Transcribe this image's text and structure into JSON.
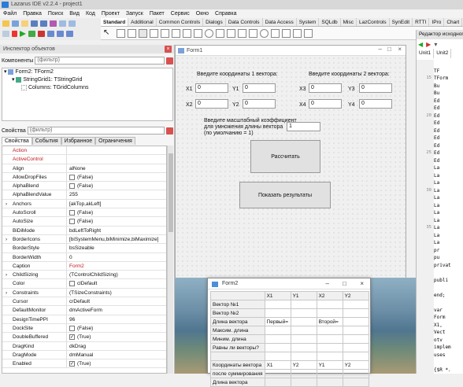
{
  "app": {
    "title": "Lazarus IDE v2.2.4 - project1"
  },
  "menu": [
    "Файл",
    "Правка",
    "Поиск",
    "Вид",
    "Код",
    "Проект",
    "Запуск",
    "Пакет",
    "Сервис",
    "Окно",
    "Справка"
  ],
  "palette_tabs": [
    "Standard",
    "Additional",
    "Common Controls",
    "Dialogs",
    "Data Controls",
    "Data Access",
    "System",
    "SQLdb",
    "Misc",
    "LazControls",
    "SynEdit",
    "RTTI",
    "IPro",
    "Chart",
    "Pa"
  ],
  "inspector": {
    "title": "Инспектор объектов",
    "components_label": "Компоненты",
    "filter_placeholder": "(фильтр)",
    "tree": [
      "Form2: TForm2",
      "StringGrid1: TStringGrid",
      "Columns: TGridColumns"
    ],
    "props_label": "Свойства",
    "tabs": [
      "Свойства",
      "События",
      "Избранное",
      "Ограничения"
    ],
    "rows": [
      {
        "name": "Action",
        "value": "",
        "name_red": true
      },
      {
        "name": "ActiveControl",
        "value": "",
        "name_red": true
      },
      {
        "name": "Align",
        "value": "alNone"
      },
      {
        "name": "AllowDropFiles",
        "value": "(False)",
        "check": true
      },
      {
        "name": "AlphaBlend",
        "value": "(False)",
        "check": true
      },
      {
        "name": "AlphaBlendValue",
        "value": "255"
      },
      {
        "name": "Anchors",
        "value": "[akTop,akLeft]",
        "expander": true
      },
      {
        "name": "AutoScroll",
        "value": "(False)",
        "check": true
      },
      {
        "name": "AutoSize",
        "value": "(False)",
        "check": true
      },
      {
        "name": "BiDiMode",
        "value": "bdLeftToRight"
      },
      {
        "name": "BorderIcons",
        "value": "[biSystemMenu,biMinimize,biMaximize]",
        "expander": true
      },
      {
        "name": "BorderStyle",
        "value": "bsSizeable"
      },
      {
        "name": "BorderWidth",
        "value": "0"
      },
      {
        "name": "Caption",
        "value": "Form2",
        "value_red": true
      },
      {
        "name": "ChildSizing",
        "value": "(TControlChildSizing)",
        "expander": true
      },
      {
        "name": "Color",
        "value": "clDefault",
        "check": true
      },
      {
        "name": "Constraints",
        "value": "(TSizeConstraints)",
        "expander": true
      },
      {
        "name": "Cursor",
        "value": "crDefault"
      },
      {
        "name": "DefaultMonitor",
        "value": "dmActiveForm"
      },
      {
        "name": "DesignTimePPI",
        "value": "96"
      },
      {
        "name": "DockSite",
        "value": "(False)",
        "check": true
      },
      {
        "name": "DoubleBuffered",
        "value": "(True)",
        "check": true,
        "checked": true
      },
      {
        "name": "DragKind",
        "value": "dkDrag"
      },
      {
        "name": "DragMode",
        "value": "dmManual"
      },
      {
        "name": "Enabled",
        "value": "(True)",
        "check": true,
        "checked": true
      }
    ]
  },
  "form1": {
    "title": "Form1",
    "vec1_label": "Введите координаты 1 вектора:",
    "vec2_label": "Введите координаты 2 вектора:",
    "labels": {
      "x1": "X1",
      "y1": "Y1",
      "x2": "X2",
      "y2": "Y2",
      "x3": "X3",
      "y3": "Y3",
      "x4": "X4",
      "y4": "Y4"
    },
    "values": {
      "x1": "0",
      "y1": "0",
      "x2": "0",
      "y2": "0",
      "x3": "0",
      "y3": "0",
      "x4": "0",
      "y4": "0"
    },
    "scale_label_1": "Введите масштабный коэффициент",
    "scale_label_2": "для умножения длины вектора",
    "scale_label_3": "(по умолчанию = 1)",
    "scale_value": "1",
    "calc_button": "Рассчитать",
    "show_button": "Показать результаты"
  },
  "editor": {
    "header": "Редактор исходного кода",
    "tabs": [
      "Unit1",
      "Unit2"
    ],
    "gutter": [
      "",
      "",
      "15",
      "",
      "",
      "",
      "",
      "20",
      "",
      "",
      "",
      "",
      "25",
      "",
      "",
      "",
      "",
      "30",
      "",
      "",
      "",
      "",
      "35",
      "",
      "",
      "",
      "",
      "",
      "",
      "",
      "",
      "",
      "",
      "",
      "",
      "",
      "",
      "",
      "",
      "",
      "",
      "",
      "",
      "",
      "45",
      "",
      "",
      "50",
      ""
    ],
    "lines": [
      "",
      "TF",
      "TForm",
      "Bu",
      "Bu",
      "Ed",
      "Ed",
      "Ed",
      "Ed",
      "Ed",
      "Ed",
      "Ed",
      "Ed",
      "Ed",
      "La",
      "La",
      "La",
      "La",
      "La",
      "La",
      "La",
      "La",
      "La",
      "La",
      "La",
      "pr",
      "pu",
      "privat",
      "",
      "publi",
      "",
      "end;",
      "",
      "var",
      "Form",
      "X1,",
      "Vect",
      "otv",
      "implem",
      "uses",
      "",
      "{$R *."
    ]
  },
  "form2": {
    "title": "Form2",
    "header": [
      "",
      "X1",
      "Y1",
      "X2",
      "Y2"
    ],
    "rows": [
      [
        "Вектор №1",
        "",
        "",
        "",
        ""
      ],
      [
        "Вектор №2",
        "",
        "",
        "",
        ""
      ],
      [
        "Длина вектора",
        "Первый=",
        "",
        "Второй=",
        ""
      ],
      [
        "Максим. длина",
        "",
        "",
        "",
        ""
      ],
      [
        "Миним. длина",
        "",
        "",
        "",
        ""
      ],
      [
        "Равны ли векторы?",
        "",
        "",
        "",
        ""
      ],
      [
        "",
        "",
        "",
        "",
        ""
      ],
      [
        "Координаты вектора",
        "X1",
        "Y2",
        "Y1",
        "Y2"
      ],
      [
        "после суммирования",
        "",
        "",
        "",
        ""
      ],
      [
        "Длина вектора",
        "",
        "",
        "",
        ""
      ]
    ]
  }
}
